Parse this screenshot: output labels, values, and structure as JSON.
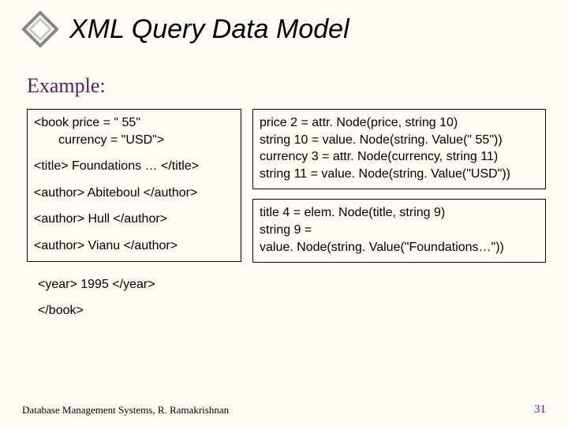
{
  "title": "XML Query Data Model",
  "subhead": "Example:",
  "left_box": {
    "l1": "<book price = \" 55\"",
    "l2": "       currency = \"USD\">",
    "l3": "<title> Foundations … </title>",
    "l4": "<author> Abiteboul </author>",
    "l5": "<author> Hull </author>",
    "l6": "<author> Vianu </author>"
  },
  "left_no_box": {
    "l7": "<year> 1995 </year>",
    "l8": "</book>"
  },
  "right_box1": {
    "r1": "price 2 = attr. Node(price, string 10)",
    "r2": "string 10 = value. Node(string. Value(\" 55\"))",
    "r3": "currency 3 = attr. Node(currency, string 11)",
    "r4": "string 11 = value. Node(string. Value(\"USD\"))"
  },
  "right_box2": {
    "r5": "title 4 = elem. Node(title, string 9)",
    "r6": "string 9 =",
    "r7": "value. Node(string. Value(\"Foundations…\"))"
  },
  "footer_text": "Database Management Systems, R. Ramakrishnan",
  "page_number": "31"
}
